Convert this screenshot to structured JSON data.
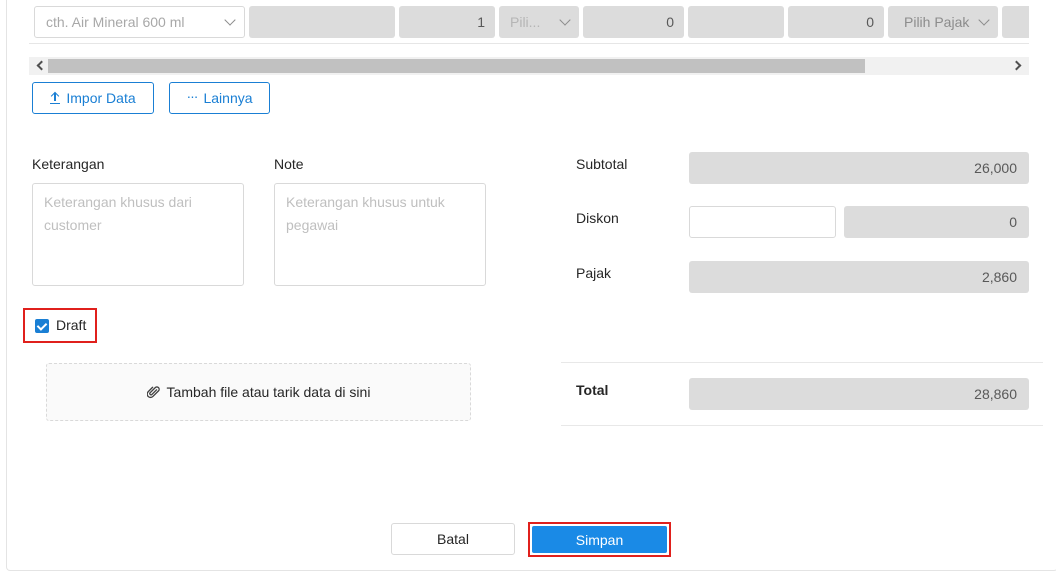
{
  "product_row": {
    "product_placeholder": "cth. Air Mineral 600 ml",
    "quantity": "1",
    "unit_placeholder": "Pili...",
    "price": "0",
    "discount": "0",
    "tax_placeholder": "Pilih Pajak"
  },
  "actions": {
    "import_label": "Impor Data",
    "more_label": "Lainnya"
  },
  "notes": {
    "keterangan_label": "Keterangan",
    "keterangan_placeholder": "Keterangan khusus dari customer",
    "note_label": "Note",
    "note_placeholder": "Keterangan khusus untuk pegawai"
  },
  "draft": {
    "label": "Draft",
    "checked": true
  },
  "attachment": {
    "label": "Tambah file atau tarik data di sini"
  },
  "totals": {
    "subtotal_label": "Subtotal",
    "subtotal_value": "26,000",
    "diskon_label": "Diskon",
    "diskon_value": "0",
    "pajak_label": "Pajak",
    "pajak_value": "2,860",
    "total_label": "Total",
    "total_value": "28,860"
  },
  "footer": {
    "cancel_label": "Batal",
    "save_label": "Simpan"
  },
  "colors": {
    "primary": "#1a8ae6",
    "highlight": "#e0201c"
  }
}
